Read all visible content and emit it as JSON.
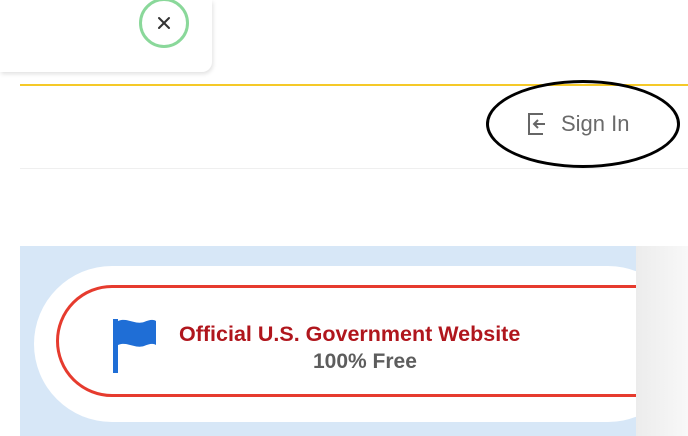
{
  "close_button": {
    "label": "×",
    "icon": "close-icon",
    "border_color": "#8ad89a"
  },
  "header": {
    "divider_color": "#f5c928",
    "signin": {
      "label": "Sign In",
      "icon": "sign-in-icon"
    }
  },
  "banner": {
    "background_color": "#d7e7f7",
    "border_color": "#e63b2e",
    "flag_icon": "flag-icon",
    "flag_color": "#1f6ed6",
    "title": "Official U.S. Government Website",
    "title_color": "#b0161d",
    "subtitle": "100% Free"
  }
}
